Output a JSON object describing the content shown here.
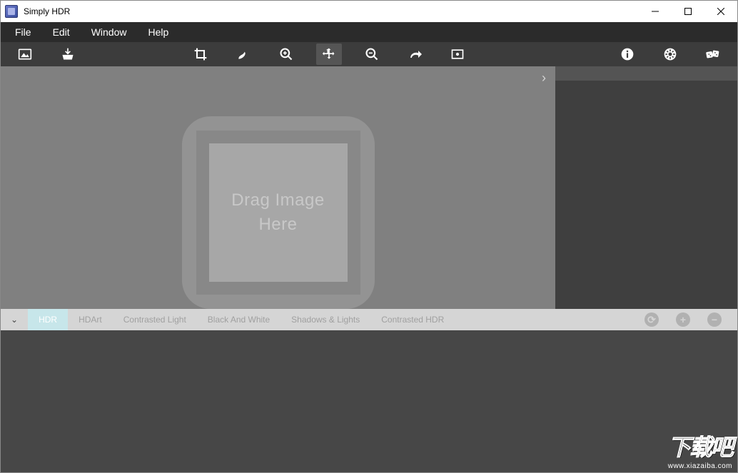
{
  "titlebar": {
    "title": "Simply HDR"
  },
  "menubar": {
    "items": [
      "File",
      "Edit",
      "Window",
      "Help"
    ]
  },
  "toolbar": {
    "left": [
      {
        "name": "open-image-icon"
      },
      {
        "name": "save-image-icon"
      }
    ],
    "center": [
      {
        "name": "crop-icon"
      },
      {
        "name": "brush-icon"
      },
      {
        "name": "zoom-in-icon"
      },
      {
        "name": "move-icon",
        "active": true
      },
      {
        "name": "zoom-out-icon"
      },
      {
        "name": "redo-icon"
      },
      {
        "name": "compare-icon"
      }
    ],
    "right": [
      {
        "name": "info-icon"
      },
      {
        "name": "settings-icon"
      },
      {
        "name": "dice-icon"
      }
    ]
  },
  "canvas": {
    "placeholder_line1": "Drag Image",
    "placeholder_line2": "Here"
  },
  "category_bar": {
    "items": [
      "HDR",
      "HDArt",
      "Contrasted Light",
      "Black And White",
      "Shadows & Lights",
      "Contrasted HDR"
    ],
    "active_index": 0,
    "controls": [
      {
        "name": "random-preset-icon",
        "glyph": "⟳"
      },
      {
        "name": "add-preset-icon",
        "glyph": "+"
      },
      {
        "name": "remove-preset-icon",
        "glyph": "−"
      }
    ]
  },
  "watermark": {
    "big": "下载吧",
    "small": "www.xiazaiba.com"
  }
}
